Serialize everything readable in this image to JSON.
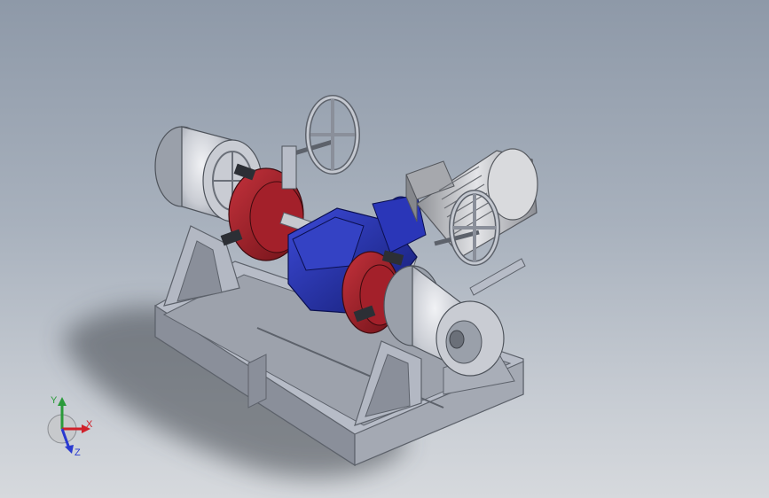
{
  "viewport": {
    "background_top": "#8e99a8",
    "background_bottom": "#d6d9dd"
  },
  "model": {
    "colors": {
      "frame": "#b7bcc7",
      "frame_dark": "#8a8f9a",
      "drum": "#c9ccd3",
      "drum_dark": "#9aa0aa",
      "brake": "#a3202a",
      "brake_dark": "#6e1218",
      "gearbox": "#2431b0",
      "gearbox_dark": "#141c70",
      "motor": "#bdbfc2",
      "shaft": "#c7c9ce",
      "shadow": "#4b5058"
    },
    "icons": [
      "handwheel-icon",
      "motor-icon",
      "gearbox-icon",
      "drum-icon"
    ]
  },
  "triad": {
    "x_label": "X",
    "y_label": "Y",
    "z_label": "Z",
    "x_color": "#d0202a",
    "y_color": "#2a9a3a",
    "z_color": "#2a3ad0"
  }
}
